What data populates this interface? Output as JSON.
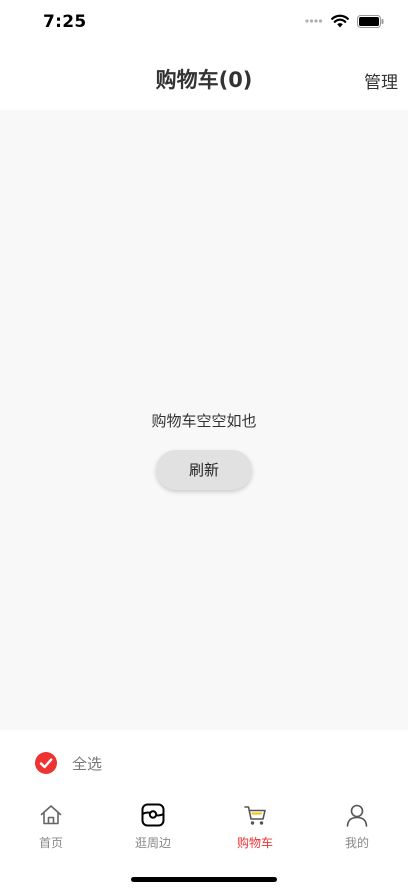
{
  "status_bar": {
    "time": "7:25"
  },
  "nav": {
    "title": "购物车(0)",
    "action_label": "管理"
  },
  "content": {
    "empty_message": "购物车空空如也",
    "refresh_label": "刷新"
  },
  "select_bar": {
    "label": "全选",
    "checked": true
  },
  "tabs": [
    {
      "label": "首页",
      "icon": "home-icon",
      "active": false
    },
    {
      "label": "逛周边",
      "icon": "browse-icon",
      "active": false
    },
    {
      "label": "购物车",
      "icon": "cart-icon",
      "active": true
    },
    {
      "label": "我的",
      "icon": "profile-icon",
      "active": false
    }
  ],
  "colors": {
    "accent": "#ee3333",
    "content_bg": "#f8f8f8",
    "text_primary": "#333333",
    "text_secondary": "#888888"
  }
}
